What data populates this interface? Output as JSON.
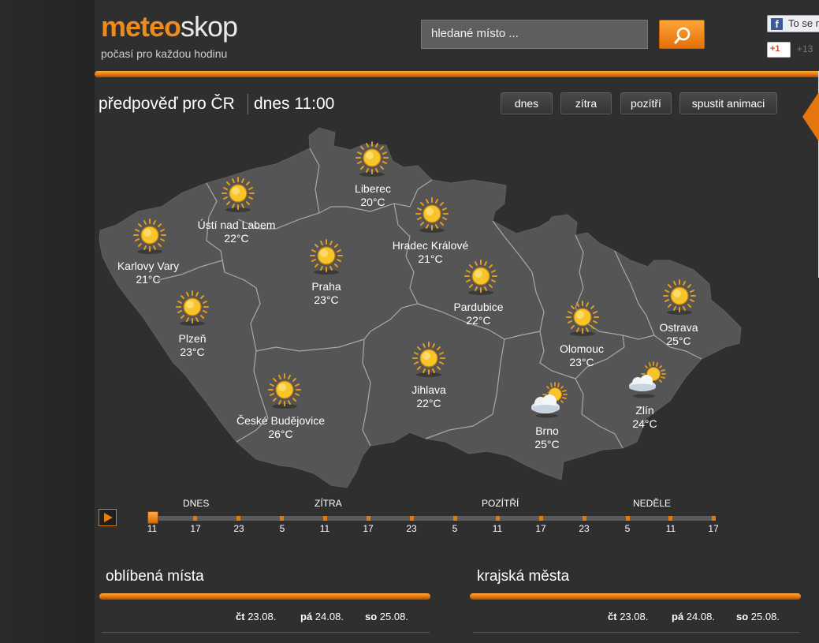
{
  "header": {
    "logo_part1": "meteo",
    "logo_part2": "skop",
    "tagline": "počasí pro každou hodinu",
    "search_placeholder": "hledané místo ...",
    "search_button_icon": "search-icon",
    "facebook_label": "To se m",
    "gplus_label": "+1",
    "gplus_count": "+13"
  },
  "forecast": {
    "title": "předpověď pro ČR",
    "time_label": "dnes 11:00",
    "buttons": [
      "dnes",
      "zítra",
      "pozítří",
      "spustit animaci"
    ]
  },
  "map": {
    "cities": [
      {
        "name": "Liberec",
        "temp": "20°C",
        "icon": "sun-icon"
      },
      {
        "name": "Ústí nad Labem",
        "temp": "22°C",
        "icon": "sun-icon"
      },
      {
        "name": "Hradec Králové",
        "temp": "21°C",
        "icon": "sun-icon"
      },
      {
        "name": "Karlovy Vary",
        "temp": "21°C",
        "icon": "sun-icon"
      },
      {
        "name": "Praha",
        "temp": "23°C",
        "icon": "sun-icon"
      },
      {
        "name": "Pardubice",
        "temp": "22°C",
        "icon": "sun-icon"
      },
      {
        "name": "Plzeň",
        "temp": "23°C",
        "icon": "sun-icon"
      },
      {
        "name": "Olomouc",
        "temp": "23°C",
        "icon": "sun-icon"
      },
      {
        "name": "Ostrava",
        "temp": "25°C",
        "icon": "sun-icon"
      },
      {
        "name": "Jihlava",
        "temp": "22°C",
        "icon": "sun-icon"
      },
      {
        "name": "České Budějovice",
        "temp": "26°C",
        "icon": "sun-icon"
      },
      {
        "name": "Brno",
        "temp": "25°C",
        "icon": "partly-cloudy-icon"
      },
      {
        "name": "Zlín",
        "temp": "24°C",
        "icon": "partly-cloudy-icon"
      }
    ]
  },
  "timeline": {
    "days": [
      "DNES",
      "ZÍTRA",
      "POZÍTŘÍ",
      "NEDĚLE"
    ],
    "hours": [
      "11",
      "17",
      "23",
      "5",
      "11",
      "17",
      "23",
      "5",
      "11",
      "17",
      "23",
      "5",
      "11",
      "17"
    ],
    "selected_index": 0
  },
  "favorites": {
    "title": "oblíbená místa",
    "dates": [
      {
        "day": "čt",
        "date": "23.08."
      },
      {
        "day": "pá",
        "date": "24.08."
      },
      {
        "day": "so",
        "date": "25.08."
      }
    ]
  },
  "regional": {
    "title": "krajská města",
    "dates": [
      {
        "day": "čt",
        "date": "23.08."
      },
      {
        "day": "pá",
        "date": "24.08."
      },
      {
        "day": "so",
        "date": "25.08."
      }
    ]
  }
}
